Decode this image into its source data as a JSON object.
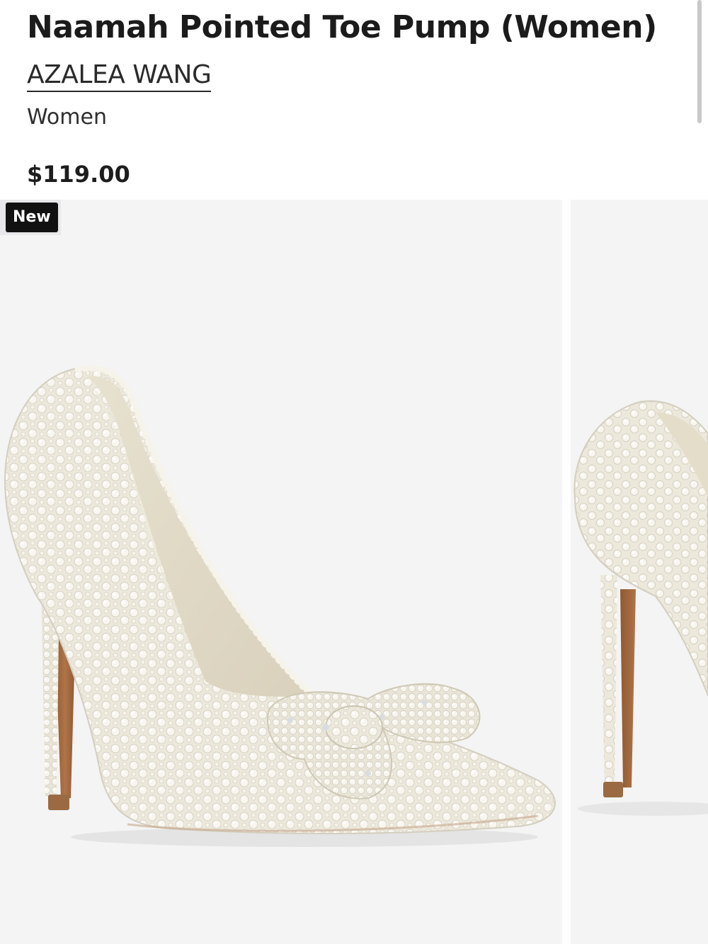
{
  "product": {
    "title": "Naamah Pointed Toe Pump (Women)",
    "brand": "AZALEA WANG",
    "category": "Women",
    "price": "$119.00"
  },
  "gallery": {
    "badge": "New",
    "images": [
      {
        "subject": "white pearl-embellished pointed toe stiletto pump with pearl bow, side view"
      },
      {
        "subject": "white pearl-embellished pointed toe stiletto pump, partial view"
      }
    ]
  },
  "colors": {
    "text": "#1b1b1b",
    "badge_bg": "#111111",
    "image_bg": "#f4f4f4",
    "pearl": "#f3f0e6",
    "heel_leather": "#a0673c"
  }
}
